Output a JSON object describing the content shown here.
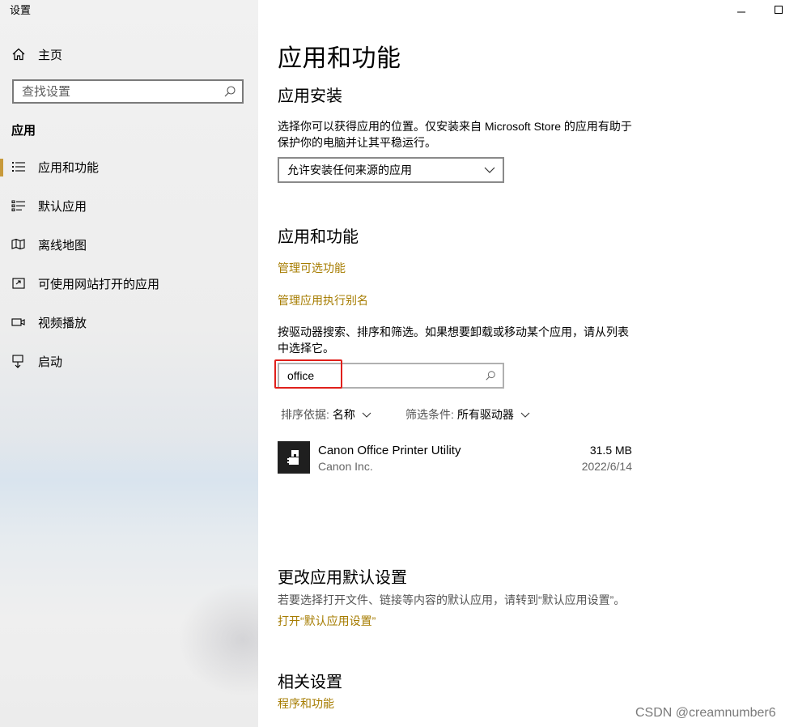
{
  "window": {
    "title": "设置",
    "minimize_icon": "minimize-icon",
    "maximize_icon": "maximize-icon"
  },
  "sidebar": {
    "home_label": "主页",
    "search_placeholder": "查找设置",
    "section_title": "应用",
    "items": [
      {
        "label": "应用和功能",
        "icon": "apps-features-icon",
        "selected": true
      },
      {
        "label": "默认应用",
        "icon": "default-apps-icon",
        "selected": false
      },
      {
        "label": "离线地图",
        "icon": "offline-maps-icon",
        "selected": false
      },
      {
        "label": "可使用网站打开的应用",
        "icon": "apps-for-websites-icon",
        "selected": false
      },
      {
        "label": "视频播放",
        "icon": "video-playback-icon",
        "selected": false
      },
      {
        "label": "启动",
        "icon": "startup-icon",
        "selected": false
      }
    ],
    "accent_color": "#c89a3b"
  },
  "main": {
    "page_title": "应用和功能",
    "install": {
      "heading": "应用安装",
      "description": "选择你可以获得应用的位置。仅安装来自 Microsoft Store 的应用有助于保护你的电脑并让其平稳运行。",
      "dropdown_value": "允许安装任何来源的应用"
    },
    "apps": {
      "heading": "应用和功能",
      "link_optional": "管理可选功能",
      "link_alias": "管理应用执行别名",
      "description": "按驱动器搜索、排序和筛选。如果想要卸载或移动某个应用，请从列表中选择它。",
      "search_value": "office",
      "sort_label": "排序依据:",
      "sort_value": "名称",
      "filter_label": "筛选条件:",
      "filter_value": "所有驱动器",
      "list": [
        {
          "name": "Canon Office Printer Utility",
          "publisher": "Canon Inc.",
          "size": "31.5 MB",
          "date": "2022/6/14"
        }
      ]
    },
    "defaults": {
      "heading": "更改应用默认设置",
      "description": "若要选择打开文件、链接等内容的默认应用，请转到“默认应用设置”。",
      "link": "打开“默认应用设置”"
    },
    "related": {
      "heading": "相关设置",
      "link": "程序和功能"
    },
    "link_color": "#a67c00"
  },
  "watermark": "CSDN @creamnumber6"
}
